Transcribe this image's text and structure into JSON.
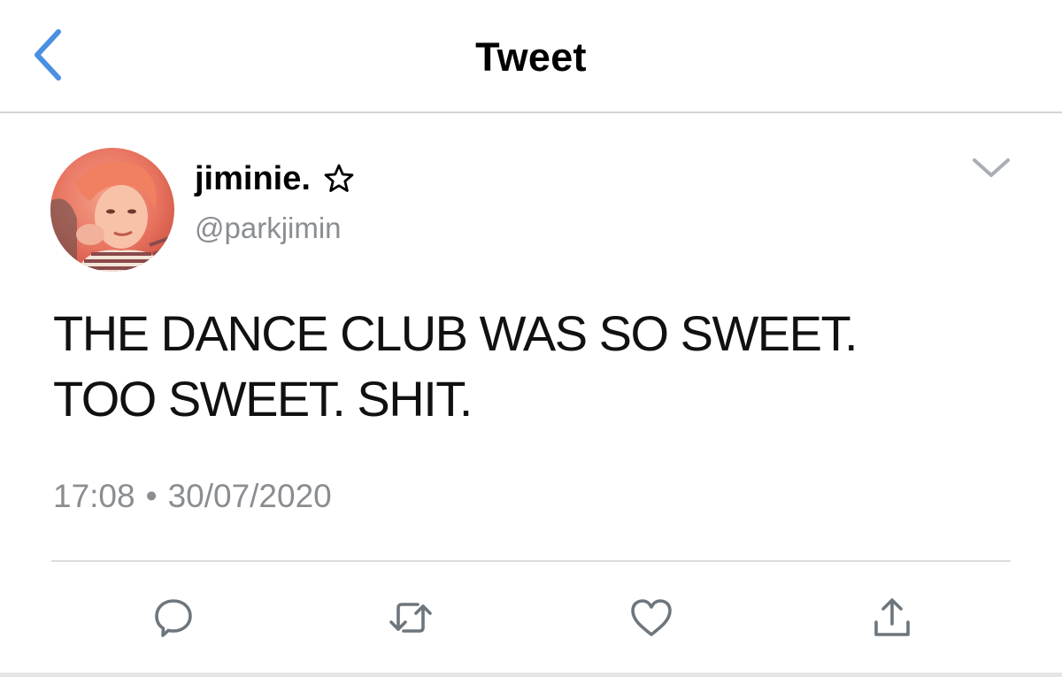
{
  "header": {
    "title": "Tweet",
    "back_icon": "chevron-left-icon",
    "accent_color": "#4a90e2"
  },
  "tweet": {
    "author": {
      "display_name": "jiminie.",
      "badge_icon": "star-outline-icon",
      "handle": "@parkjimin",
      "avatar": "profile-photo"
    },
    "more_icon": "chevron-down-icon",
    "text": "THE DANCE CLUB WAS SO SWEET.\nTOO SWEET. SHIT.",
    "time": "17:08",
    "separator": "•",
    "date": "30/07/2020"
  },
  "actions": [
    {
      "name": "reply",
      "icon": "reply-bubble-icon"
    },
    {
      "name": "retweet",
      "icon": "retweet-icon"
    },
    {
      "name": "like",
      "icon": "heart-icon"
    },
    {
      "name": "share",
      "icon": "share-icon"
    }
  ],
  "colors": {
    "secondary_text": "#8a8d91",
    "icon_gray": "#6e767d",
    "divider": "#dcdcdc"
  }
}
